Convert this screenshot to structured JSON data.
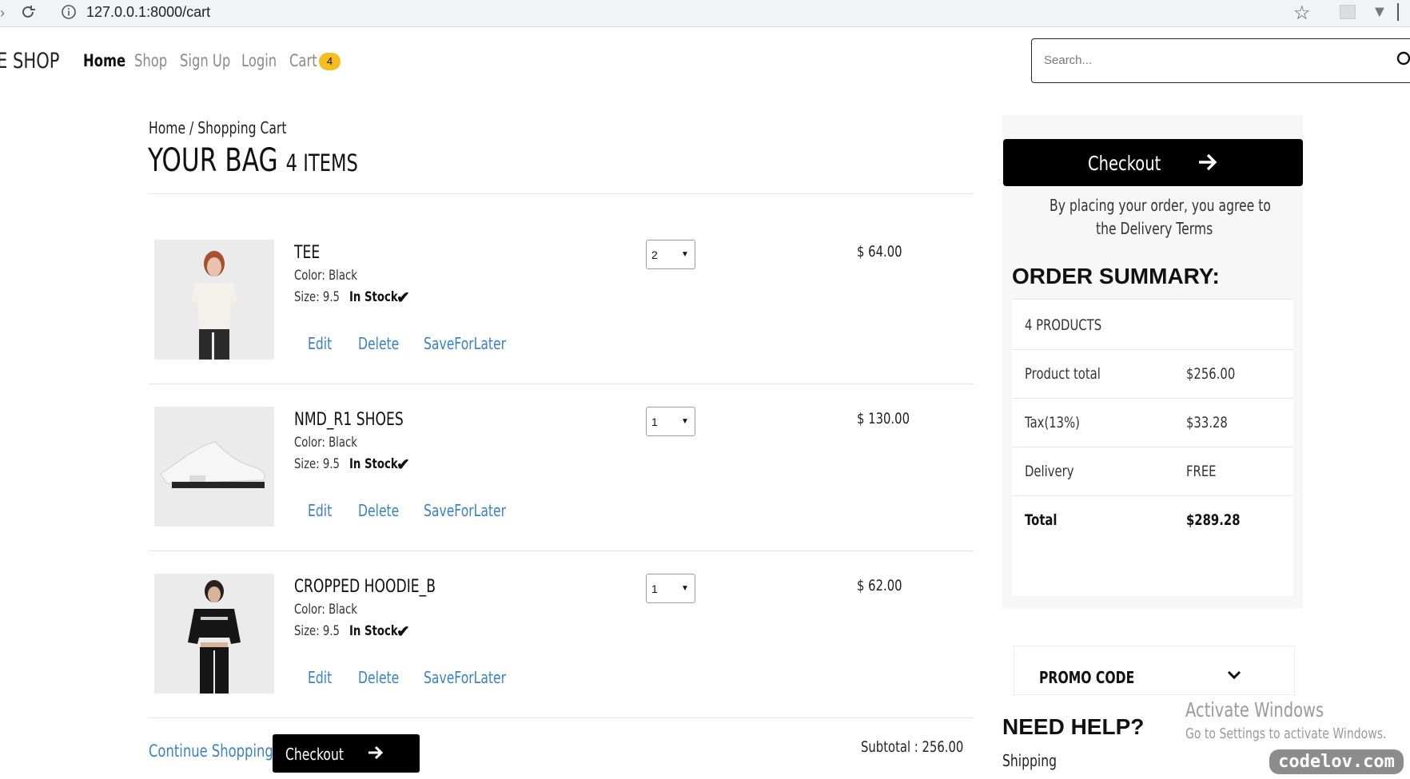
{
  "browser": {
    "url": "127.0.0.1:8000/cart"
  },
  "nav": {
    "brand": "E SHOP",
    "items": [
      {
        "label": "Home"
      },
      {
        "label": "Shop"
      },
      {
        "label": "Sign Up"
      },
      {
        "label": "Login"
      },
      {
        "label": "Cart"
      }
    ],
    "cart_count": "4",
    "search_placeholder": "Search..."
  },
  "page": {
    "breadcrumb": "Home / Shopping Cart",
    "title": "YOUR BAG",
    "item_count": "4 ITEMS"
  },
  "cart": {
    "items": [
      {
        "name": "TEE",
        "color": "Color: Black",
        "size": "Size: 9.5",
        "stock": "In Stock",
        "qty": "2",
        "price": "$ 64.00",
        "image": "woman in white t-shirt"
      },
      {
        "name": "NMD_R1 SHOES",
        "color": "Color: Black",
        "size": "Size: 9.5",
        "stock": "In Stock",
        "qty": "1",
        "price": "$ 130.00",
        "image": "white sneaker"
      },
      {
        "name": "CROPPED HOODIE_B",
        "color": "Color: Black",
        "size": "Size: 9.5",
        "stock": "In Stock",
        "qty": "1",
        "price": "$ 62.00",
        "image": "woman in black cropped hoodie"
      }
    ],
    "actions": {
      "edit": "Edit",
      "delete": "Delete",
      "save": "SaveForLater"
    },
    "continue_label": "Continue Shopping",
    "checkout_label": "Checkout",
    "subtotal": "Subtotal : 256.00"
  },
  "sidebar": {
    "checkout_label": "Checkout",
    "terms_line1": "By placing your order, you agree to",
    "terms_line2": "the Delivery Terms",
    "summary_title": "ORDER SUMMARY:",
    "products": "4 PRODUCTS",
    "rows": [
      {
        "label": "Product total",
        "value": "$256.00"
      },
      {
        "label": "Tax(13%)",
        "value": "$33.28"
      },
      {
        "label": "Delivery",
        "value": "FREE"
      },
      {
        "label": "Total",
        "value": "$289.28"
      }
    ],
    "promo_label": "PROMO CODE",
    "help_title": "NEED HELP?",
    "help_first": "Shipping"
  },
  "overlay": {
    "activate_title": "Activate Windows",
    "activate_sub": "Go to Settings to activate Windows.",
    "watermark": "codelov.com"
  },
  "colors": {
    "link": "#3b82c4",
    "badge": "#f5bd1f",
    "button": "#000000"
  }
}
